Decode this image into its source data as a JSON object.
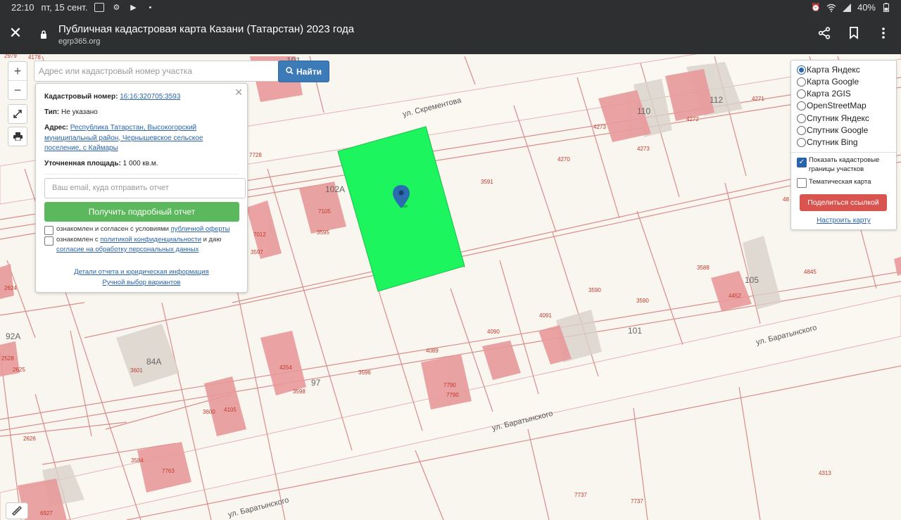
{
  "status_bar": {
    "time": "22:10",
    "date": "пт, 15 сент.",
    "battery": "40%",
    "icons": [
      "notification-icon",
      "settings-icon",
      "play-icon",
      "dot-icon",
      "alarm-icon",
      "wifi-icon",
      "signal-icon",
      "battery-icon"
    ]
  },
  "browser": {
    "title": "Публичная кадастровая карта Казани (Татарстан) 2023 года",
    "url": "egrp365.org",
    "icons": [
      "close-icon",
      "lock-icon",
      "share-icon",
      "bookmark-icon",
      "more-icon"
    ]
  },
  "search": {
    "placeholder": "Адрес или кадастровый номер участка",
    "button_label": "Найти"
  },
  "controls": {
    "zoom_in": "+",
    "zoom_out": "−"
  },
  "info": {
    "cadastral_label": "Кадастровый номер:",
    "cadastral_number": "16:16:320705:3593",
    "type_label": "Тип:",
    "type_value": "Не указано",
    "address_label": "Адрес:",
    "address_value": "Республика Татарстан, Высокогорский муниципальный район, Чернышевское сельское поселение, с Каймары",
    "area_label": "Уточненная площадь:",
    "area_value": "1 000 кв.м.",
    "email_placeholder": "Ваш email, куда отправить отчет",
    "report_button": "Получить подробный отчет",
    "agree1_text": "ознакомлен и согласен с условиями",
    "agree1_link": "публичной оферты",
    "agree2_text": "ознакомлен с",
    "agree2_link": "политикой конфиденциальности",
    "agree2_mid": "и даю",
    "agree2_link2": "согласие на обработку персональных данных",
    "details_link": "Детали отчета и юридическая информация",
    "manual_link": "Ручной выбор вариантов"
  },
  "layers": {
    "options": [
      {
        "label": "Карта Яндекс",
        "selected": true
      },
      {
        "label": "Карта Google",
        "selected": false
      },
      {
        "label": "Карта 2GIS",
        "selected": false
      },
      {
        "label": "OpenStreetMap",
        "selected": false
      },
      {
        "label": "Спутник Яндекс",
        "selected": false
      },
      {
        "label": "Спутник Google",
        "selected": false
      },
      {
        "label": "Спутник Bing",
        "selected": false
      }
    ],
    "show_boundaries_label": "Показать кадастровые границы участков",
    "show_boundaries": true,
    "thematic_label": "Тематическая карта",
    "thematic": false,
    "share_button": "Поделиться ссылкой",
    "setup_link": "Настроить карту"
  },
  "map": {
    "streets": [
      "ул. Скрементова",
      "ул. Баратынского",
      "ул. Баратынского",
      "ул. Баратынского"
    ],
    "house_numbers": [
      "101",
      "110",
      "112",
      "102А",
      "105",
      "101",
      "92А",
      "84А",
      "97"
    ],
    "parcel_labels": [
      "2979",
      "4178",
      "4271",
      "4273",
      "4273",
      "4272",
      "7728",
      "4270",
      "3591",
      "7105",
      "3595",
      "7012",
      "3597",
      "3588",
      "4845",
      "3590",
      "3590",
      "4452",
      "4091",
      "4090",
      "4089",
      "3596",
      "7790",
      "7790",
      "3601",
      "4254",
      "3598",
      "3600",
      "4105",
      "3584",
      "7763",
      "2626",
      "2625",
      "2624",
      "6927",
      "7737",
      "7737",
      "4313",
      "2528",
      "48"
    ]
  },
  "colors": {
    "selected_parcel": "#1cf55e",
    "building": "#e8999a",
    "parcel_border": "#d98c8c",
    "toolbar_bg": "#2d2f31",
    "search_button": "#3d7ab8",
    "report_button": "#5cb85c",
    "share_button": "#d9534f",
    "marker": "#2b6cb0"
  }
}
